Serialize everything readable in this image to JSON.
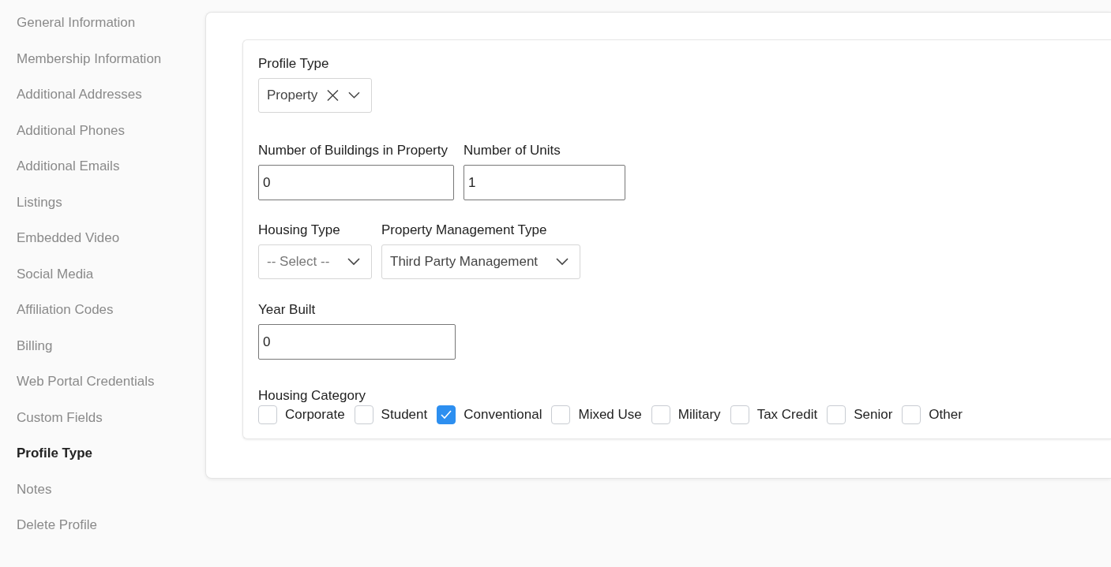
{
  "sidebar": {
    "items": [
      {
        "label": "General Information",
        "selected": false
      },
      {
        "label": "Membership Information",
        "selected": false
      },
      {
        "label": "Additional Addresses",
        "selected": false
      },
      {
        "label": "Additional Phones",
        "selected": false
      },
      {
        "label": "Additional Emails",
        "selected": false
      },
      {
        "label": "Listings",
        "selected": false
      },
      {
        "label": "Embedded Video",
        "selected": false
      },
      {
        "label": "Social Media",
        "selected": false
      },
      {
        "label": "Affiliation Codes",
        "selected": false
      },
      {
        "label": "Billing",
        "selected": false
      },
      {
        "label": "Web Portal Credentials",
        "selected": false
      },
      {
        "label": "Custom Fields",
        "selected": false
      },
      {
        "label": "Profile Type",
        "selected": true
      },
      {
        "label": "Notes",
        "selected": false
      },
      {
        "label": "Delete Profile",
        "selected": false
      }
    ]
  },
  "form": {
    "rows": [
      [
        {
          "kind": "select",
          "label": "Profile Type",
          "value": "Property",
          "clearable": true
        }
      ],
      [
        {
          "kind": "text",
          "label": "Number of Buildings in Property",
          "value": "0"
        },
        {
          "kind": "text",
          "label": "Number of Units",
          "value": "1"
        }
      ],
      [
        {
          "kind": "select",
          "label": "Housing Type",
          "placeholder": "-- Select --"
        },
        {
          "kind": "select",
          "label": "Property Management Type",
          "value": "Third Party Management"
        }
      ],
      [
        {
          "kind": "text",
          "label": "Year Built",
          "value": "0"
        }
      ]
    ],
    "housing_category": {
      "label": "Housing Category",
      "options": [
        {
          "label": "Corporate",
          "checked": false
        },
        {
          "label": "Student",
          "checked": false
        },
        {
          "label": "Conventional",
          "checked": true
        },
        {
          "label": "Mixed Use",
          "checked": false
        },
        {
          "label": "Military",
          "checked": false
        },
        {
          "label": "Tax Credit",
          "checked": false
        },
        {
          "label": "Senior",
          "checked": false
        },
        {
          "label": "Other",
          "checked": false
        }
      ]
    }
  }
}
